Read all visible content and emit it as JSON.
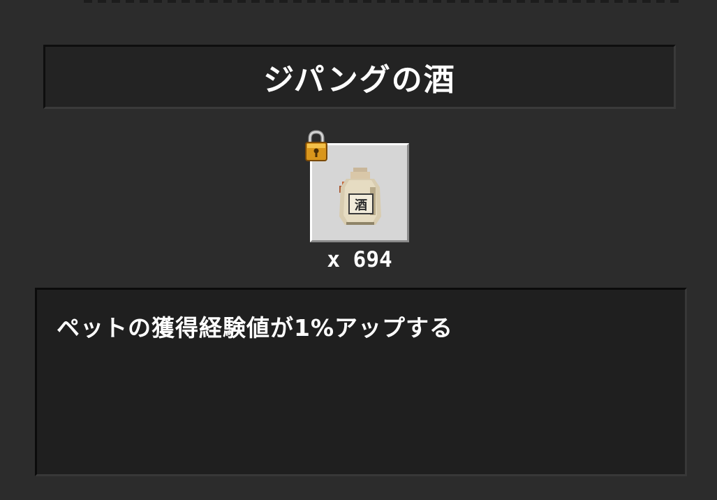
{
  "item": {
    "title": "ジパングの酒",
    "count": "x 694",
    "description": "ペットの獲得経験値が1%アップする",
    "icon": "sake-bottle-icon",
    "locked": true,
    "lock_icon": "padlock-icon"
  },
  "colors": {
    "panel_bg": "#2c2c2c",
    "title_bg": "#232323",
    "slot_bg": "#d6d6d6",
    "desc_bg": "#1f1f1f",
    "text": "#ffffff",
    "lock_gold": "#e0a020"
  }
}
